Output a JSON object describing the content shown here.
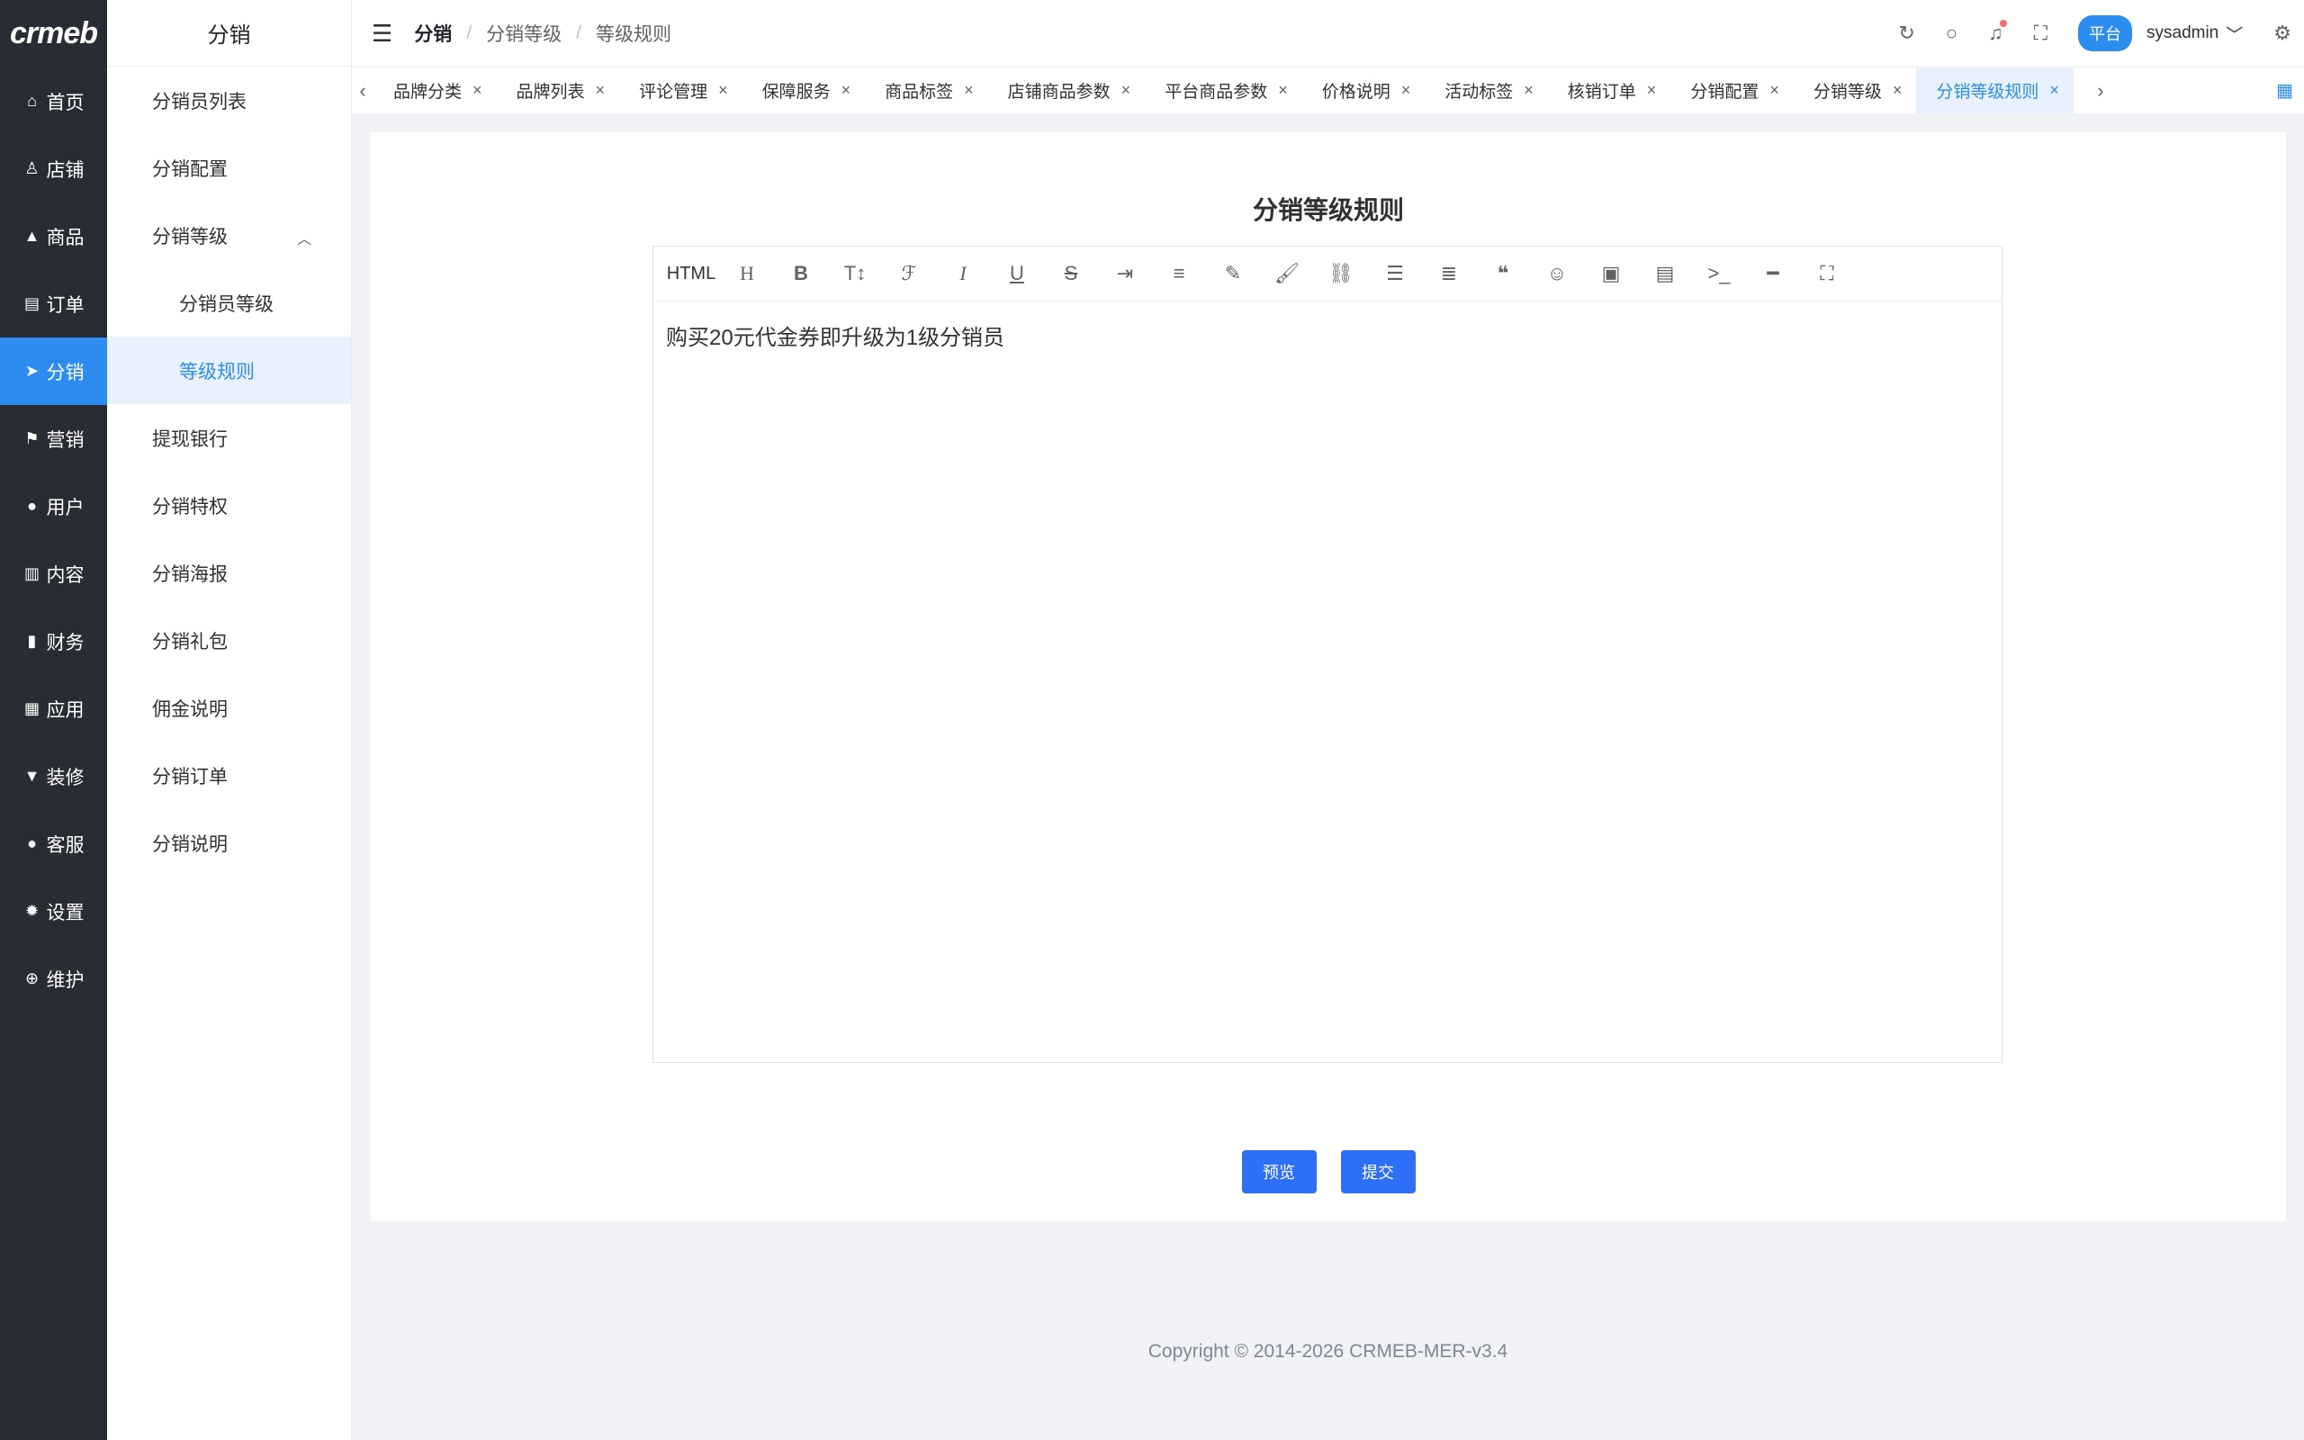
{
  "rail": {
    "logo": "crmeb",
    "items": [
      {
        "label": "首页",
        "icon": "home-icon",
        "glyph": "⌂"
      },
      {
        "label": "店铺",
        "icon": "store-icon",
        "glyph": "♙"
      },
      {
        "label": "商品",
        "icon": "bag-icon",
        "glyph": "▲"
      },
      {
        "label": "订单",
        "icon": "clipboard-icon",
        "glyph": "▤"
      },
      {
        "label": "分销",
        "icon": "send-icon",
        "glyph": "➤"
      },
      {
        "label": "营销",
        "icon": "flag-icon",
        "glyph": "⚑"
      },
      {
        "label": "用户",
        "icon": "user-icon",
        "glyph": "●"
      },
      {
        "label": "内容",
        "icon": "book-icon",
        "glyph": "▥"
      },
      {
        "label": "财务",
        "icon": "bar-chart-icon",
        "glyph": "▮"
      },
      {
        "label": "应用",
        "icon": "apps-icon",
        "glyph": "▦"
      },
      {
        "label": "装修",
        "icon": "brush-icon",
        "glyph": "▼"
      },
      {
        "label": "客服",
        "icon": "service-icon",
        "glyph": "●"
      },
      {
        "label": "设置",
        "icon": "gear-icon",
        "glyph": "✹"
      },
      {
        "label": "维护",
        "icon": "maintenance-icon",
        "glyph": "⊕"
      }
    ]
  },
  "subnav": {
    "title": "分销",
    "items": [
      {
        "label": "分销员列表"
      },
      {
        "label": "分销配置"
      },
      {
        "label": "分销等级"
      },
      {
        "label": "分销员等级"
      },
      {
        "label": "等级规则"
      },
      {
        "label": "提现银行"
      },
      {
        "label": "分销特权"
      },
      {
        "label": "分销海报"
      },
      {
        "label": "分销礼包"
      },
      {
        "label": "佣金说明"
      },
      {
        "label": "分销订单"
      },
      {
        "label": "分销说明"
      }
    ]
  },
  "header": {
    "breadcrumb": [
      "分销",
      "分销等级",
      "等级规则"
    ],
    "role": "平台",
    "user": "sysadmin"
  },
  "tabs": [
    {
      "label": "品牌分类"
    },
    {
      "label": "品牌列表"
    },
    {
      "label": "评论管理"
    },
    {
      "label": "保障服务"
    },
    {
      "label": "商品标签"
    },
    {
      "label": "店铺商品参数"
    },
    {
      "label": "平台商品参数"
    },
    {
      "label": "价格说明"
    },
    {
      "label": "活动标签"
    },
    {
      "label": "核销订单"
    },
    {
      "label": "分销配置"
    },
    {
      "label": "分销等级"
    },
    {
      "label": "分销等级规则"
    }
  ],
  "page": {
    "title": "分销等级规则",
    "editor_html_label": "HTML",
    "content": "购买20元代金券即升级为1级分销员",
    "preview_label": "预览",
    "submit_label": "提交"
  },
  "footer": "Copyright © 2014-2026 CRMEB-MER-v3.4"
}
